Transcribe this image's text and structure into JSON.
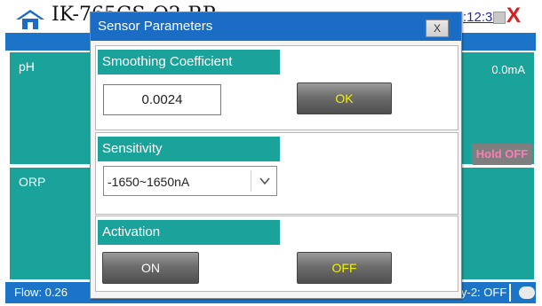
{
  "app": {
    "title": "IK-765GS-O2-RP",
    "clock": ":12:39",
    "close_glyph": "X"
  },
  "panels": {
    "ph_label": "pH",
    "ph_current": "0.0mA",
    "hold_button": "Hold OFF",
    "orp_label": "ORP"
  },
  "statusbar": {
    "flow": "Flow: 0.26",
    "relay": "y-2: OFF"
  },
  "dialog": {
    "title": "Sensor Parameters",
    "close_label": "X",
    "smoothing": {
      "header": "Smoothing Coefficient",
      "value": "0.0024",
      "ok_label": "OK"
    },
    "sensitivity": {
      "header": "Sensitivity",
      "selected": "-1650~1650nA"
    },
    "activation": {
      "header": "Activation",
      "on_label": "ON",
      "off_label": "OFF"
    }
  },
  "colors": {
    "teal": "#1aa39a",
    "blue": "#1b6cc4",
    "yellow_text": "#f2f200",
    "close_red": "#d81e1e"
  },
  "icons": {
    "home": "home-icon",
    "chevron": "chevron-down-icon",
    "toggle": "toggle-icon"
  }
}
